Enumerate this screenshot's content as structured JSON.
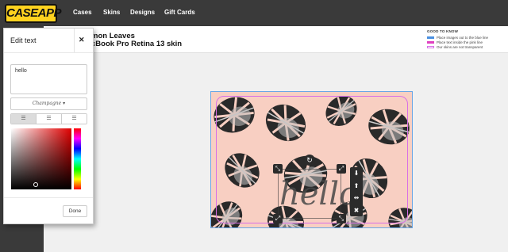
{
  "brand": {
    "logo_text": "CASEAPP"
  },
  "nav": {
    "items": [
      "Cases",
      "Skins",
      "Designs",
      "Gift Cards"
    ]
  },
  "product": {
    "title": "mon Leaves",
    "subtitle": "cBook Pro Retina 13 skin"
  },
  "legend": {
    "title": "GOOD TO KNOW",
    "items": [
      {
        "text": "Place images out to the blue line",
        "color": "#4a8fe0"
      },
      {
        "text": "Place text inside the pink line",
        "color": "#e040c0"
      },
      {
        "text": "Our skins are not transparent",
        "color": "#ffffff"
      }
    ]
  },
  "panel": {
    "title": "Edit text",
    "text_value": "hello",
    "font_selected": "Champagne",
    "done_label": "Done"
  },
  "canvas": {
    "text": "hello"
  },
  "colors": {
    "nav_bg": "#3a3a3a",
    "logo_bg": "#ffd21f",
    "skin_bg": "#f8cfc2",
    "blue_line": "#6aa7e6",
    "pink_line": "#d86fe6"
  }
}
